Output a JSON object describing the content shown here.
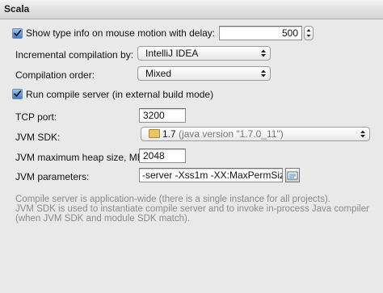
{
  "section": {
    "title": "Scala"
  },
  "type_info": {
    "checkbox_label": "Show type info on mouse motion with delay:",
    "checked": true,
    "delay_value": "500"
  },
  "incremental": {
    "label": "Incremental compilation by:",
    "selected": "IntelliJ IDEA"
  },
  "order": {
    "label": "Compilation order:",
    "selected": "Mixed"
  },
  "compile_server": {
    "checkbox_label": "Run compile server (in external build mode)",
    "checked": true
  },
  "tcp": {
    "label": "TCP port:",
    "value": "3200"
  },
  "jvm_sdk": {
    "label": "JVM SDK:",
    "selected_version": "1.7",
    "selected_detail": "(java version \"1.7.0_11\")",
    "icon": "folder-icon"
  },
  "heap": {
    "label": "JVM maximum heap size, MB:",
    "value": "2048"
  },
  "jvm_params": {
    "label": "JVM parameters:",
    "value": "-server -Xss1m -XX:MaxPermSiz",
    "expand_icon": "expand-text-icon"
  },
  "help_text": {
    "line1": "Compile server is application-wide (there is a single instance for all projects).",
    "line2": "JVM SDK is used to instantiate compile server and to invoke in-process Java compiler",
    "line3": "(when JVM SDK and module SDK match)."
  },
  "colors": {
    "background": "#e9e9e9",
    "checkbox_accent": "#3e7fd3",
    "help_text": "#8b8b8b"
  }
}
